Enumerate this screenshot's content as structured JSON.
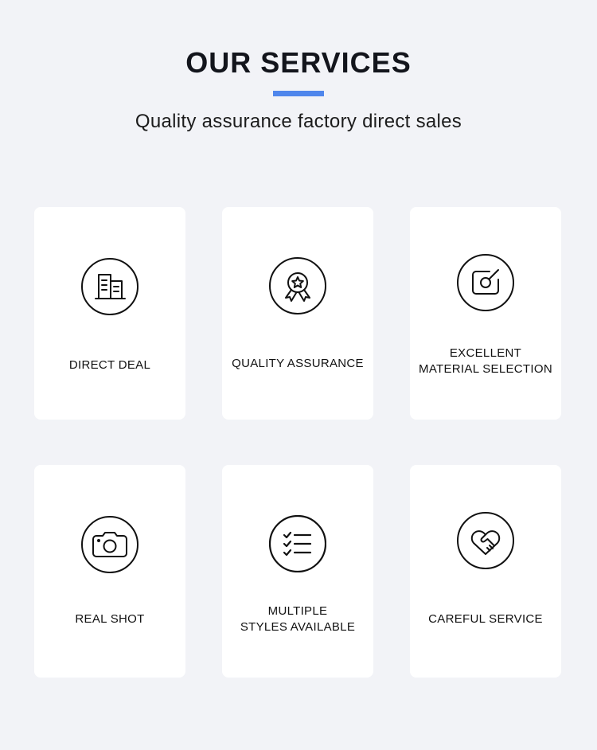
{
  "header": {
    "title": "OUR SERVICES",
    "subtitle": "Quality assurance factory direct sales",
    "accent_color": "#4f86ec"
  },
  "services": [
    {
      "icon": "building-icon",
      "lines": [
        "DIRECT DEAL"
      ]
    },
    {
      "icon": "award-ribbon-icon",
      "lines": [
        "QUALITY ASSURANCE"
      ]
    },
    {
      "icon": "selection-square-icon",
      "lines": [
        "EXCELLENT",
        "MATERIAL SELECTION"
      ]
    },
    {
      "icon": "camera-icon",
      "lines": [
        "REAL SHOT"
      ]
    },
    {
      "icon": "checklist-icon",
      "lines": [
        "MULTIPLE",
        "STYLES AVAILABLE"
      ]
    },
    {
      "icon": "heart-handshake-icon",
      "lines": [
        "CAREFUL SERVICE"
      ]
    }
  ]
}
